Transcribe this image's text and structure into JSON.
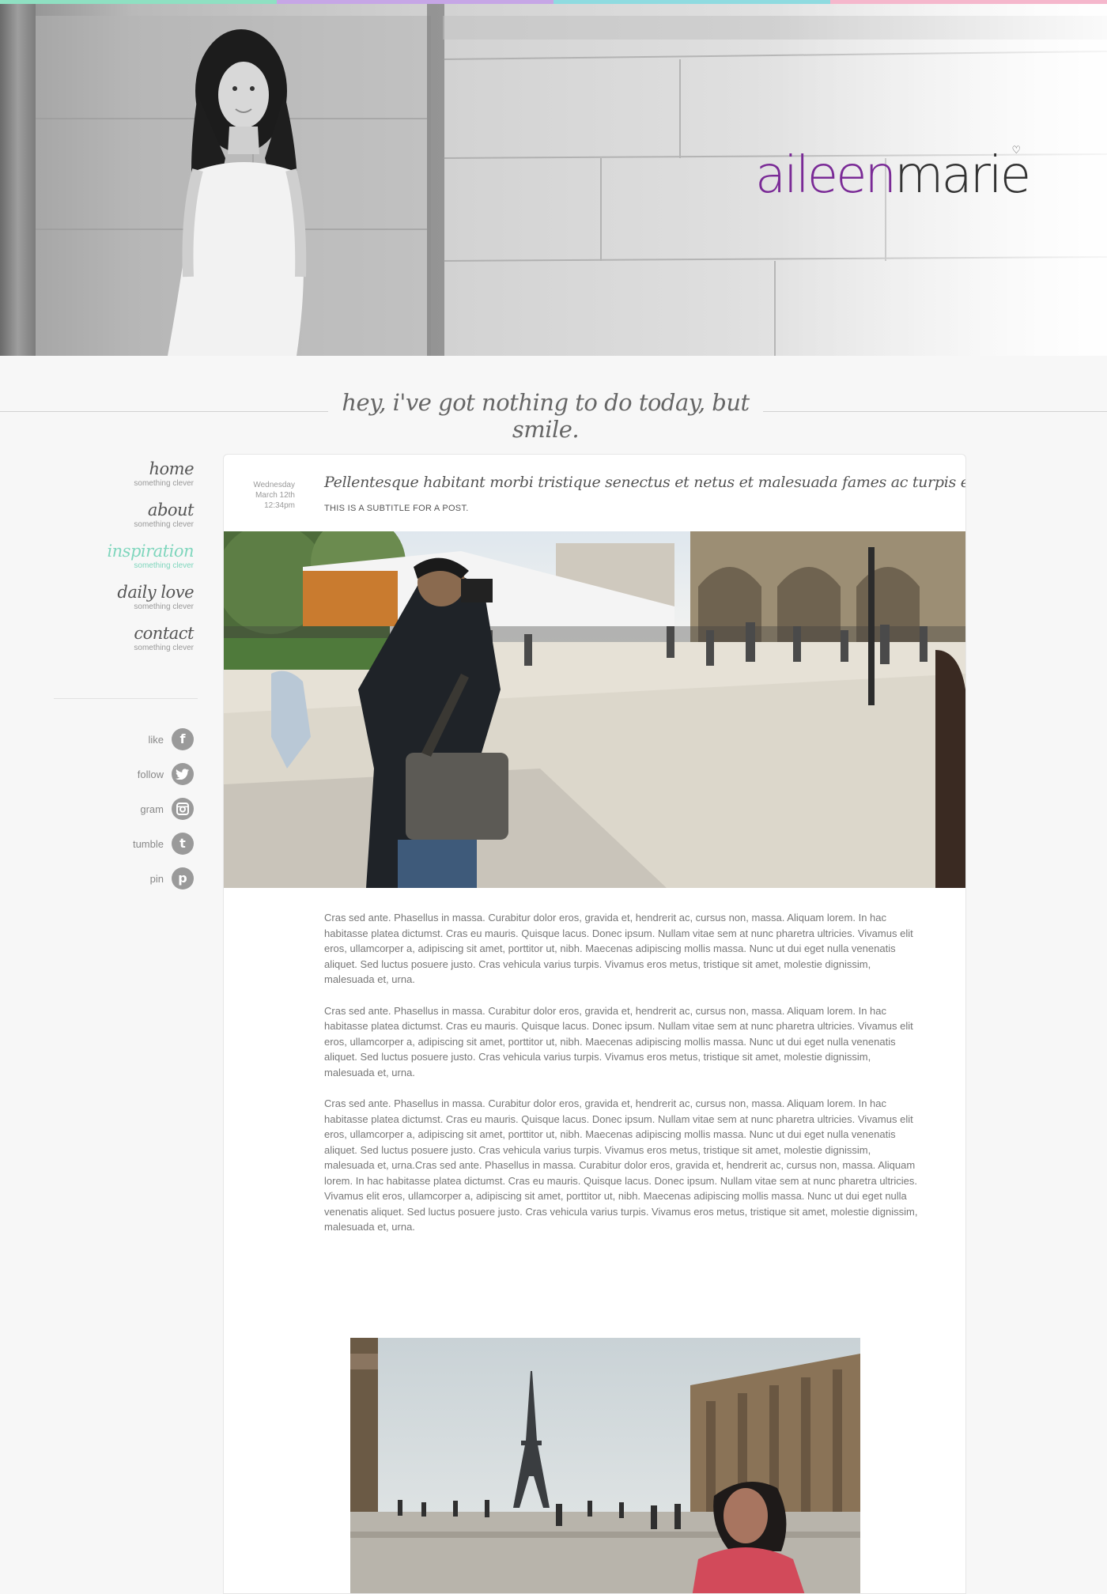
{
  "header": {
    "stripe_colors": [
      "#8fe0c2",
      "#c6a6e6",
      "#8fdbe0",
      "#f5b7cc"
    ],
    "logo_first": "aileen",
    "logo_second": "marie",
    "logo_heart": "♡",
    "brand_color": "#7a2a96"
  },
  "tagline": "hey, i've got nothing to do today, but smile.",
  "nav": {
    "accent_color": "#7fd6bd",
    "items": [
      {
        "label": "home",
        "sub": "something clever"
      },
      {
        "label": "about",
        "sub": "something clever"
      },
      {
        "label": "inspiration",
        "sub": "something clever",
        "active": true
      },
      {
        "label": "daily love",
        "sub": "something clever"
      },
      {
        "label": "contact",
        "sub": "something clever"
      }
    ]
  },
  "social": [
    {
      "label": "like",
      "icon": "facebook-icon",
      "glyph": "f"
    },
    {
      "label": "follow",
      "icon": "twitter-icon",
      "glyph": "t"
    },
    {
      "label": "gram",
      "icon": "instagram-icon",
      "glyph": "◘"
    },
    {
      "label": "tumble",
      "icon": "tumblr-icon",
      "glyph": "t"
    },
    {
      "label": "pin",
      "icon": "pinterest-icon",
      "glyph": "p"
    }
  ],
  "post": {
    "date": {
      "weekday": "Wednesday",
      "day": "March 12th",
      "time": "12:34pm"
    },
    "title": "Pellentesque habitant morbi tristique senectus et netus et malesuada fames ac turpis egestas.",
    "subtitle": "THIS IS A SUBTITLE FOR A POST.",
    "paragraphs": [
      "Cras sed ante. Phasellus in massa. Curabitur dolor eros, gravida et, hendrerit ac, cursus non, massa. Aliquam lorem. In hac habitasse platea dictumst. Cras eu mauris. Quisque lacus. Donec ipsum. Nullam vitae sem at nunc pharetra ultricies. Vivamus elit eros, ullamcorper a, adipiscing sit amet, porttitor ut, nibh. Maecenas adipiscing mollis massa. Nunc ut dui eget nulla venenatis aliquet. Sed luctus posuere justo. Cras vehicula varius turpis. Vivamus eros metus, tristique sit amet, molestie dignissim, malesuada et, urna.",
      "Cras sed ante. Phasellus in massa. Curabitur dolor eros, gravida et, hendrerit ac, cursus non, massa. Aliquam lorem. In hac habitasse platea dictumst. Cras eu mauris. Quisque lacus. Donec ipsum. Nullam vitae sem at nunc pharetra ultricies. Vivamus elit eros, ullamcorper a, adipiscing sit amet, porttitor ut, nibh. Maecenas adipiscing mollis massa. Nunc ut dui eget nulla venenatis aliquet. Sed luctus posuere justo. Cras vehicula varius turpis. Vivamus eros metus, tristique sit amet, molestie dignissim, malesuada et, urna.",
      "Cras sed ante. Phasellus in massa. Curabitur dolor eros, gravida et, hendrerit ac, cursus non, massa. Aliquam lorem. In hac habitasse platea dictumst. Cras eu mauris. Quisque lacus. Donec ipsum. Nullam vitae sem at nunc pharetra ultricies. Vivamus elit eros, ullamcorper a, adipiscing sit amet, porttitor ut, nibh. Maecenas adipiscing mollis massa. Nunc ut dui eget nulla venenatis aliquet. Sed luctus posuere justo. Cras vehicula varius turpis. Vivamus eros metus, tristique sit amet, molestie dignissim, malesuada et, urna.Cras sed ante. Phasellus in massa. Curabitur dolor eros, gravida et, hendrerit ac, cursus non, massa. Aliquam lorem. In hac habitasse platea dictumst. Cras eu mauris. Quisque lacus. Donec ipsum. Nullam vitae sem at nunc pharetra ultricies. Vivamus elit eros, ullamcorper a, adipiscing sit amet, porttitor ut, nibh. Maecenas adipiscing mollis massa. Nunc ut dui eget nulla venenatis aliquet. Sed luctus posuere justo. Cras vehicula varius turpis. Vivamus eros metus, tristique sit amet, molestie dignissim, malesuada et, urna."
    ]
  }
}
